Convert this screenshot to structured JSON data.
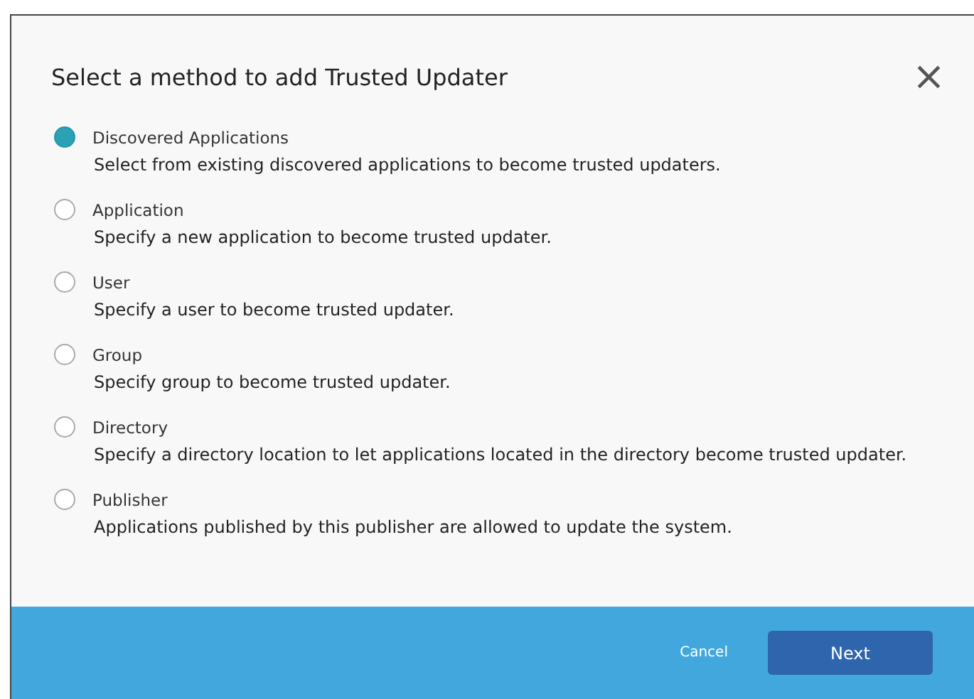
{
  "dialog": {
    "title": "Select a method to add Trusted Updater",
    "close": "×"
  },
  "options": [
    {
      "label": "Discovered Applications",
      "description": "Select from existing discovered applications to become trusted updaters.",
      "selected": true
    },
    {
      "label": "Application",
      "description": "Specify a new application to become trusted updater.",
      "selected": false
    },
    {
      "label": "User",
      "description": "Specify a user to become trusted updater.",
      "selected": false
    },
    {
      "label": "Group",
      "description": "Specify group to become trusted updater.",
      "selected": false
    },
    {
      "label": "Directory",
      "description": "Specify a directory location to let applications located in the directory become trusted updater.",
      "selected": false
    },
    {
      "label": "Publisher",
      "description": "Applications published by this publisher are allowed to update the system.",
      "selected": false
    }
  ],
  "footer": {
    "cancel": "Cancel",
    "next": "Next"
  }
}
